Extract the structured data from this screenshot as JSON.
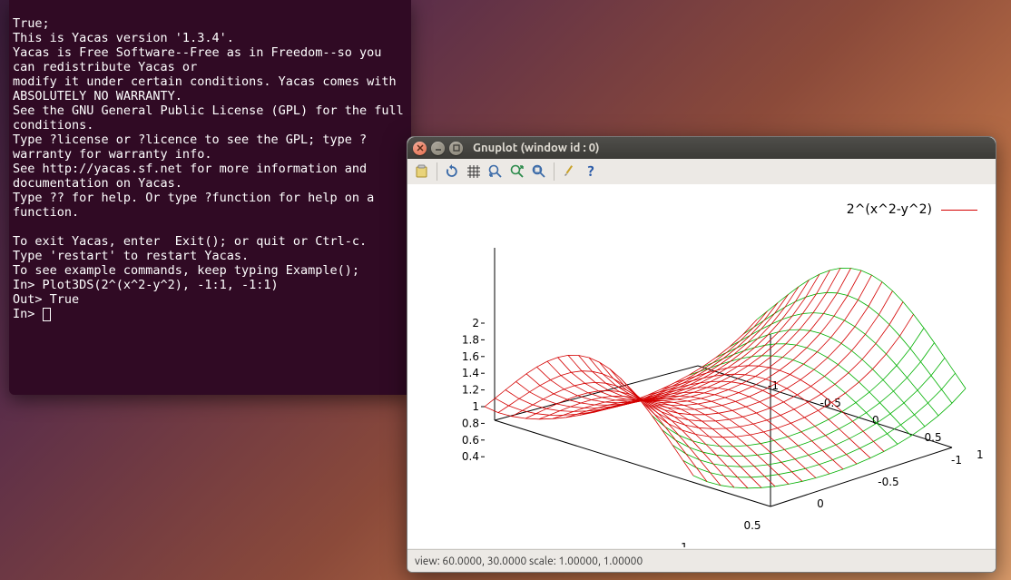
{
  "terminal": {
    "lines": [
      "True;",
      "This is Yacas version '1.3.4'.",
      "Yacas is Free Software--Free as in Freedom--so you can redistribute Yacas or",
      "modify it under certain conditions. Yacas comes with ABSOLUTELY NO WARRANTY.",
      "See the GNU General Public License (GPL) for the full conditions.",
      "Type ?license or ?licence to see the GPL; type ?warranty for warranty info.",
      "See http://yacas.sf.net for more information and documentation on Yacas.",
      "Type ?? for help. Or type ?function for help on a function.",
      "",
      "To exit Yacas, enter  Exit(); or quit or Ctrl-c.",
      "Type 'restart' to restart Yacas.",
      "To see example commands, keep typing Example();",
      "In> Plot3DS(2^(x^2-y^2), -1:1, -1:1)",
      "Out> True",
      "In> "
    ]
  },
  "gnuplot": {
    "title": "Gnuplot (window id : 0)",
    "toolbar_icons": {
      "clipboard": "clipboard-icon",
      "refresh": "refresh-icon",
      "grid": "grid-icon",
      "zoom_prev": "zoom-prev-icon",
      "zoom_next": "zoom-next-icon",
      "autoscale": "autoscale-icon",
      "config": "config-icon",
      "help": "help-icon"
    },
    "legend_label": "2^(x^2-y^2)",
    "statusbar": "view: 60.0000, 30.0000  scale: 1.00000, 1.00000"
  },
  "chart_data": {
    "type": "surface3d",
    "title": "",
    "function": "2^(x^2-y^2)",
    "x_range": [
      -1,
      1
    ],
    "y_range": [
      -1,
      1
    ],
    "z_ticks": [
      0.4,
      0.6,
      0.8,
      1,
      1.2,
      1.4,
      1.6,
      1.8,
      2
    ],
    "x_ticks": [
      -1,
      -0.5,
      0,
      0.5,
      1
    ],
    "y_ticks": [
      -1,
      -0.5,
      0,
      0.5,
      1
    ],
    "view": {
      "rot_x": 60.0,
      "rot_z": 30.0
    },
    "scale": [
      1.0,
      1.0
    ],
    "series": [
      {
        "name": "2^(x^2-y^2)",
        "color_front": "#d40000",
        "color_back": "#00c000"
      }
    ]
  }
}
